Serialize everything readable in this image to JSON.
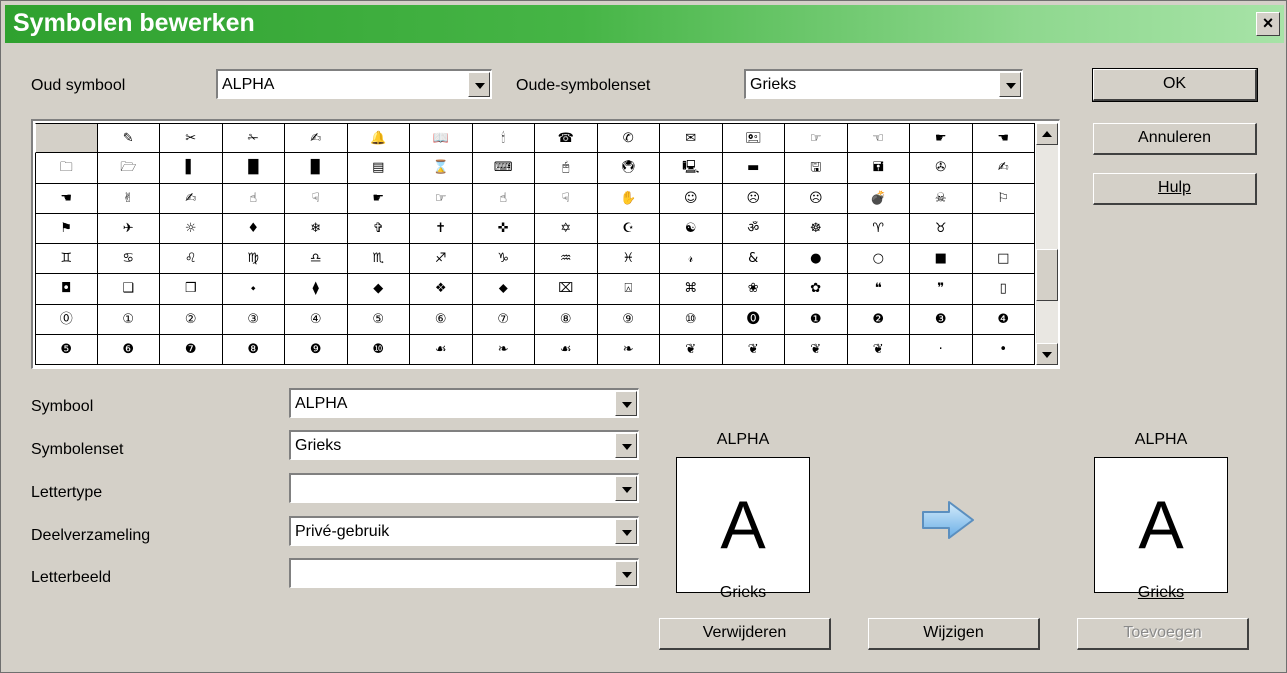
{
  "window": {
    "title": "Symbolen bewerken",
    "close_label": "×"
  },
  "old_symbol": {
    "label": "Oud symbool",
    "value": "ALPHA"
  },
  "old_symbol_set": {
    "label": "Oude-symbolenset",
    "value": "Grieks"
  },
  "buttons": {
    "ok": "OK",
    "cancel": "Annuleren",
    "help": "Hulp",
    "delete": "Verwijderen",
    "modify": "Wijzigen",
    "add": "Toevoegen"
  },
  "symbol_grid": {
    "rows": [
      [
        "",
        "✎",
        "✂",
        "✁",
        "✍",
        "🔔",
        "📖",
        "🕯",
        "☎",
        "✆",
        "✉",
        "🖭",
        "☞",
        "☜",
        "☛",
        "☚"
      ],
      [
        "🗀",
        "🗁",
        "▌",
        "█",
        "▉",
        "▤",
        "⌛",
        "⌨",
        "🖰",
        "🖲",
        "🖳",
        "▬",
        "🖫",
        "🖬",
        "✇",
        "✍"
      ],
      [
        "☚",
        "✌",
        "✍",
        "☝",
        "☟",
        "☛",
        "☞",
        "☝",
        "☟",
        "✋",
        "☺",
        "☹",
        "☹",
        "💣",
        "☠",
        "⚐"
      ],
      [
        "⚑",
        "✈",
        "☼",
        "♦",
        "❄",
        "✞",
        "✝",
        "✜",
        "✡",
        "☪",
        "☯",
        "ॐ",
        "☸",
        "♈",
        "♉",
        ""
      ],
      [
        "♊",
        "♋",
        "♌",
        "♍",
        "♎",
        "♏",
        "♐",
        "♑",
        "♒",
        "♓",
        "𝓇",
        "&",
        "●",
        "○",
        "■",
        "□"
      ],
      [
        "◘",
        "❑",
        "❒",
        "⬩",
        "⧫",
        "◆",
        "❖",
        "⬥",
        "⌧",
        "⍓",
        "⌘",
        "❀",
        "✿",
        "❝",
        "❞",
        "▯"
      ],
      [
        "⓪",
        "①",
        "②",
        "③",
        "④",
        "⑤",
        "⑥",
        "⑦",
        "⑧",
        "⑨",
        "⑩",
        "⓿",
        "❶",
        "❷",
        "❸",
        "❹"
      ],
      [
        "❺",
        "❻",
        "❼",
        "❽",
        "❾",
        "❿",
        "☙",
        "❧",
        "☙",
        "❧",
        "❦",
        "❦",
        "❦",
        "❦",
        "·",
        "•"
      ]
    ]
  },
  "form": {
    "symbol": {
      "label": "Symbool",
      "value": "ALPHA"
    },
    "symbol_set": {
      "label": "Symbolenset",
      "value": "Grieks"
    },
    "font": {
      "label": "Lettertype",
      "value": ""
    },
    "subset": {
      "label": "Deelverzameling",
      "value": "Privé-gebruik"
    },
    "typeface": {
      "label": "Letterbeeld",
      "value": ""
    }
  },
  "preview_old": {
    "name": "ALPHA",
    "glyph": "A",
    "set": "Grieks"
  },
  "preview_new": {
    "name": "ALPHA",
    "glyph": "A",
    "set": "Grieks"
  },
  "icons": {
    "arrow": "arrow-right-icon",
    "close": "close-icon",
    "dropdown": "chevron-down-icon"
  },
  "colors": {
    "title_start": "#2fa12f",
    "title_end": "#a7e3a7",
    "dialog_bg": "#d4d0c8",
    "arrow_fill": "#8fc6ef"
  }
}
